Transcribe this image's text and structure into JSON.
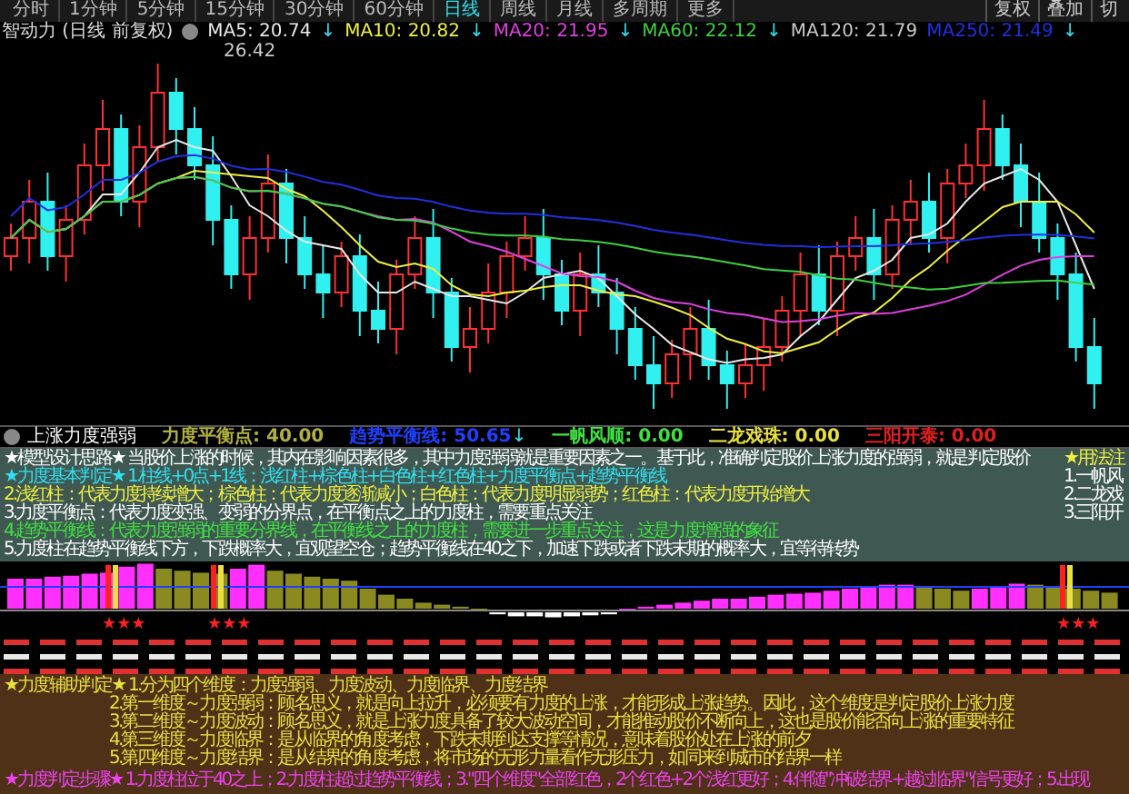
{
  "period_tabs": [
    {
      "label": "分时",
      "selected": false
    },
    {
      "label": "1分钟",
      "selected": false
    },
    {
      "label": "5分钟",
      "selected": false
    },
    {
      "label": "15分钟",
      "selected": false
    },
    {
      "label": "30分钟",
      "selected": false
    },
    {
      "label": "60分钟",
      "selected": false
    },
    {
      "label": "日线",
      "selected": true
    },
    {
      "label": "周线",
      "selected": false
    },
    {
      "label": "月线",
      "selected": false
    },
    {
      "label": "多周期",
      "selected": false
    },
    {
      "label": "更多",
      "selected": false
    }
  ],
  "toolbar_buttons": [
    "复权",
    "叠加",
    "切"
  ],
  "chart_title": "智动力 (日线 前复权)",
  "moving_averages": [
    {
      "label": "MA5: 20.74",
      "arrow": "↓",
      "color": "#e8e8e8"
    },
    {
      "label": "MA10: 20.82",
      "arrow": "↓",
      "color": "#f0f040"
    },
    {
      "label": "MA20: 21.95",
      "arrow": "↓",
      "color": "#e040e0"
    },
    {
      "label": "MA60: 22.12",
      "arrow": "↓",
      "color": "#40d040"
    },
    {
      "label": "MA120: 21.79",
      "color": "#c8c8c8"
    },
    {
      "label": "MA250: 21.49",
      "arrow": "↓",
      "color": "#2030e0"
    }
  ],
  "high_price_label": "26.42",
  "indicator": {
    "name": "上涨力度强弱",
    "values": [
      {
        "label": "力度平衡点: 40.00",
        "color": "#b0b040"
      },
      {
        "label": "趋势平衡线: 50.65",
        "arrow": "↓",
        "color": "#2040ff"
      },
      {
        "label": "一帆风顺: 0.00",
        "color": "#40e040"
      },
      {
        "label": "二龙戏珠: 0.00",
        "color": "#e8e040"
      },
      {
        "label": "三阳开泰: 0.00",
        "color": "#e02020"
      }
    ]
  },
  "signal_stars": [
    "★★★",
    "★★★",
    "★★★"
  ],
  "notes": [
    {
      "text": "★模型设计思路★ 当股价上涨的时候，其内在影响因素很多，其中力度强弱就是重要因素之一。基于此，准确判定股价上涨力度的强弱，就是判定股价",
      "color": "#ffffff"
    },
    {
      "text": "★力度基本判定★ 1.柱线+0点+1线：浅红柱+棕色柱+白色柱+红色柱+力度平衡点+趋势平衡线",
      "color": "#30e0f0"
    },
    {
      "text": "2.浅红柱：代表力度持续增大；棕色柱：代表力度逐渐减小；白色柱：代表力度明显弱势；红色柱：代表力度开始增大",
      "color": "#f0f040"
    },
    {
      "text": "3.力度平衡点：代表力度变强、变弱的分界点，在平衡点之上的力度柱，需要重点关注",
      "color": "#ffffff"
    },
    {
      "text": "4.趋势平衡线：代表力度强弱的重要分界线，在平衡线之上的力度柱，需要进一步重点关注，这是力度增强的象征",
      "color": "#40e040"
    },
    {
      "text": "5.力度柱在趋势平衡线下方，下跌概率大，宜观望空仓；趋势平衡线在40之下，加速下跌或者下跌末期的概率大，宜等待转势",
      "color": "#ffffff"
    }
  ],
  "usage_notes": {
    "title": "★用法注",
    "items": [
      "1.一帆风",
      "2.二龙戏",
      "3.三阳开"
    ]
  },
  "aux_notes": [
    {
      "text": "★力度辅助判定★ 1.分为四个维度：力度强弱、力度波动、力度临界、力度结界",
      "indented": false
    },
    {
      "text": "2.第一维度～力度强弱：顾名思义，就是向上拉升，必须要有力度的上涨，才能形成上涨趋势。因此，这个维度是判定股价上涨力度",
      "indented": true
    },
    {
      "text": "3.第二维度～力度波动：顾名思义，就是上涨力度具备了较大波动空间，才能推动股价不断向上，这也是股价能否向上涨的重要特征",
      "indented": true
    },
    {
      "text": "4.第三维度～力度临界：是从临界的角度考虑，下跌末期到达支撑等情况，意味着股价处在上涨的前夕",
      "indented": true
    },
    {
      "text": "5.第四维度～力度结界：是从结界的角度考虑，将市场的无形力量看作无形压力，如同来到城市的结界一样",
      "indented": true
    }
  ],
  "steps": "★力度判定步骤★ 1.力度柱位于40之上；2.力度柱超过趋势平衡线；3.\"四个维度\"全部红色，2个红色+2个浅红更好；4.伴随\"冲破结界+越过临界\"信号更好；5.出现"
}
